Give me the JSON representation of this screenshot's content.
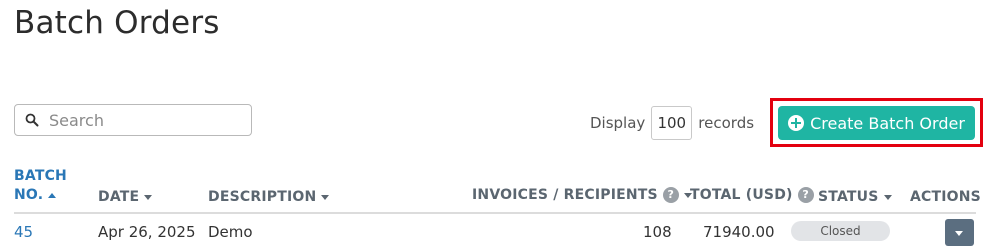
{
  "page": {
    "title": "Batch Orders"
  },
  "search": {
    "placeholder": "Search",
    "value": ""
  },
  "display": {
    "prefix": "Display",
    "value": "100",
    "suffix": "records"
  },
  "create_button": {
    "label": "Create Batch Order",
    "accent": "#1fb5a3",
    "highlight": "#e3000f"
  },
  "table": {
    "columns": {
      "batch_no_line1": "BATCH",
      "batch_no_line2": "NO.",
      "date": "DATE",
      "description": "DESCRIPTION",
      "invoices": "INVOICES / RECIPIENTS",
      "total": "TOTAL (USD)",
      "status": "STATUS",
      "actions": "ACTIONS"
    },
    "rows": [
      {
        "batch_no": "45",
        "date": "Apr 26, 2025",
        "description": "Demo",
        "invoices": "108",
        "total": "71940.00",
        "status": "Closed"
      }
    ]
  },
  "icons": {
    "search": "search-icon",
    "help": "question-circle-icon",
    "sort": "caret-down-icon",
    "sort_active": "caret-up-icon",
    "plus": "plus-circle-icon",
    "actions": "caret-down-icon"
  }
}
